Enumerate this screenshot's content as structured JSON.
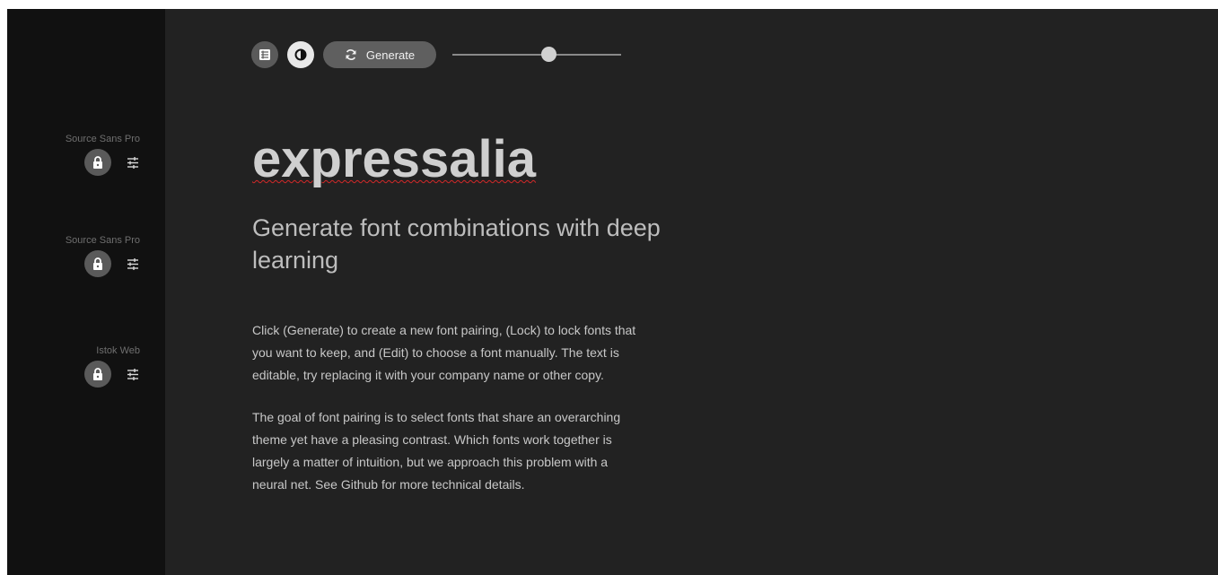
{
  "sidebar": {
    "fonts": [
      {
        "name": "Source Sans Pro"
      },
      {
        "name": "Source Sans Pro"
      },
      {
        "name": "Istok Web"
      }
    ]
  },
  "toolbar": {
    "generate_label": "Generate",
    "slider_value": 0.57
  },
  "content": {
    "title": "expressalia",
    "subtitle": "Generate font combinations with deep learning",
    "paragraph1": "Click (Generate) to create a new font pairing, (Lock) to lock fonts that you want to keep, and (Edit) to choose a font manually. The text is editable, try replacing it with your company name or other copy.",
    "paragraph2": "The goal of font pairing is to select fonts that share an overarching theme yet have a pleasing contrast. Which fonts work together is largely a matter of intuition, but we approach this problem with a neural net. See Github for more technical details."
  },
  "colors": {
    "sidebar_bg": "#111111",
    "main_bg": "#222222",
    "spell_underline": "#d42828"
  },
  "icons": [
    "menu-icon",
    "contrast-icon",
    "refresh-icon",
    "lock-icon",
    "tune-icon"
  ]
}
